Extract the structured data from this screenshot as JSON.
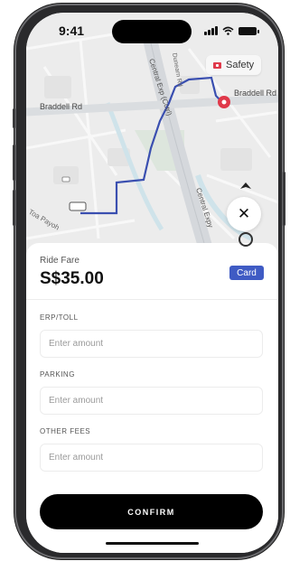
{
  "status_bar": {
    "time": "9:41"
  },
  "map": {
    "safety_label": "Safety",
    "roads": {
      "braddell_left": "Braddell Rd",
      "braddell_right": "Braddell Rd",
      "central_exp": "Central Exp (Cctrl)",
      "central_expy_lower": "Central Expy",
      "dunearn": "Dunearn Rd",
      "toa_payoh": "Toa Payoh"
    },
    "colors": {
      "route": "#3a4fb0",
      "destination_pin": "#e0394a"
    }
  },
  "close_icon": "✕",
  "fare": {
    "label": "Ride Fare",
    "amount": "S$35.00",
    "payment_badge": "Card",
    "badge_color": "#3f5bc4"
  },
  "fields": [
    {
      "label": "ERP/TOLL",
      "placeholder": "Enter amount",
      "value": ""
    },
    {
      "label": "PARKING",
      "placeholder": "Enter amount",
      "value": ""
    },
    {
      "label": "OTHER FEES",
      "placeholder": "Enter amount",
      "value": ""
    }
  ],
  "confirm_label": "CONFIRM"
}
